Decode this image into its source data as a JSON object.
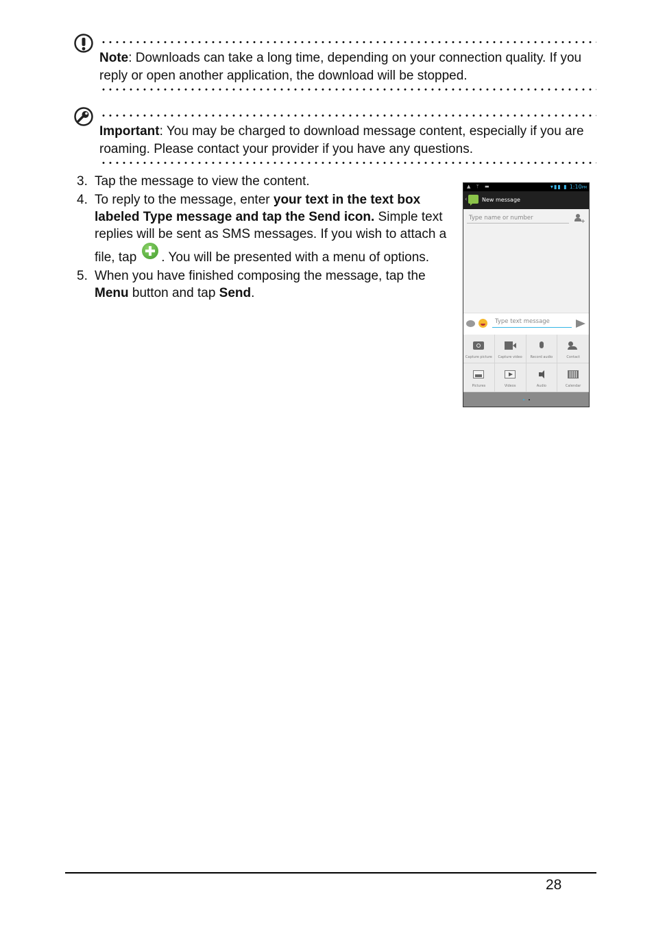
{
  "callouts": [
    {
      "type": "note",
      "icon": "exclamation-circle-icon",
      "label": "Note",
      "text": ": Downloads can take a long time, depending on your connection quality. If you reply or open another application, the download will be stopped."
    },
    {
      "type": "important",
      "icon": "wrench-circle-icon",
      "label": "Important",
      "text": ": You may be charged to download message content, especially if you are roaming. Please contact your provider if you have any questions."
    }
  ],
  "steps": [
    {
      "num": "3.",
      "parts": {
        "a": "Tap the message to view the content."
      }
    },
    {
      "num": "4.",
      "parts": {
        "a": "To reply to the message, enter ",
        "b_bold": "your text in the text box labeled Type message and tap the Send icon.",
        "c": " Simple text replies will be sent as SMS messages. If you wish to attach a file, tap",
        "icon": "green-plus-icon",
        "d": ". You will be presented with a menu of options."
      }
    },
    {
      "num": "5.",
      "parts": {
        "a": "When you have finished composing the message, tap the ",
        "b_bold": "Menu",
        "c": " button and tap ",
        "d_bold": "Send",
        "e": "."
      }
    }
  ],
  "phone": {
    "status_bar": {
      "left_icons": "▲ ᛘ ▬",
      "time": "1:10",
      "ampm": "PM"
    },
    "action_bar": {
      "title": "New message"
    },
    "recipient_placeholder": "Type name or number",
    "message_placeholder": "Type text message",
    "attachments": [
      {
        "label": "Capture picture",
        "icon": "camera"
      },
      {
        "label": "Capture video",
        "icon": "video"
      },
      {
        "label": "Record audio",
        "icon": "mic"
      },
      {
        "label": "Contact",
        "icon": "contact"
      },
      {
        "label": "Pictures",
        "icon": "pictures"
      },
      {
        "label": "Videos",
        "icon": "videos"
      },
      {
        "label": "Audio",
        "icon": "audio"
      },
      {
        "label": "Calendar",
        "icon": "calendar"
      }
    ],
    "pager": {
      "pages": 2,
      "active": 1
    },
    "colors": {
      "accent": "#33b5e5",
      "action_bar": "#202020"
    }
  },
  "footer": {
    "page_number": "28"
  }
}
